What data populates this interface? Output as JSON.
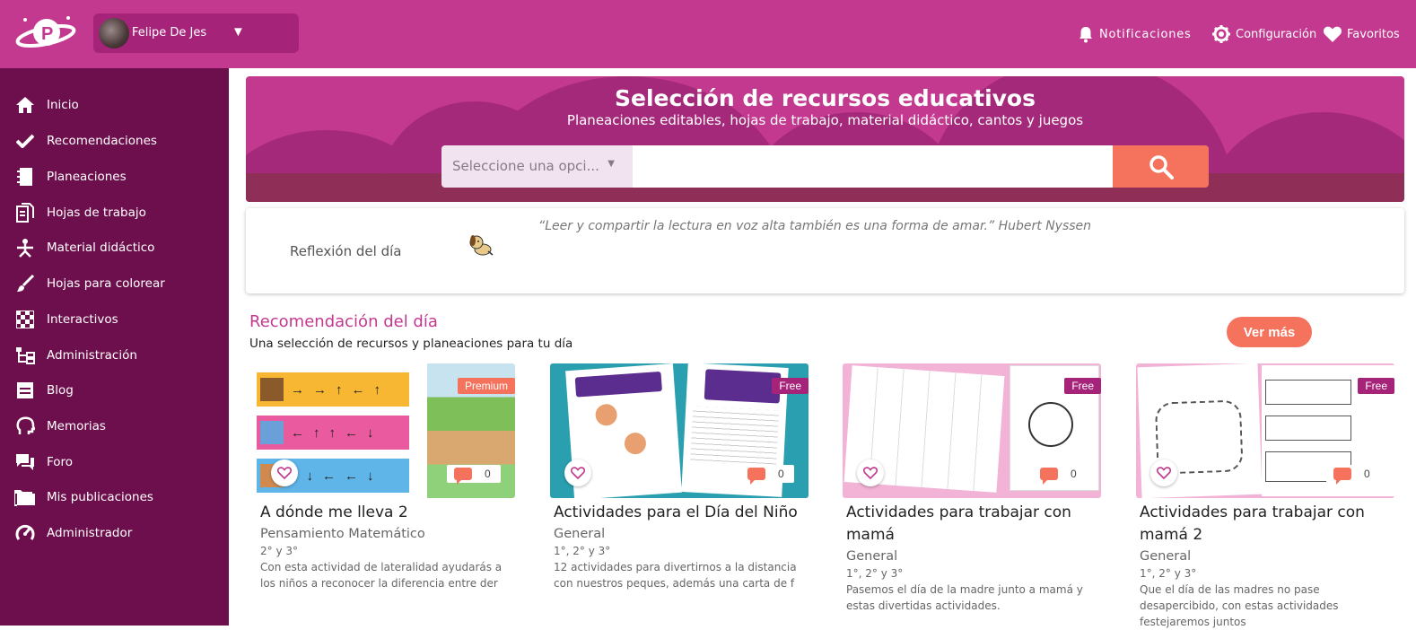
{
  "topbar": {
    "user_name": "Felipe De Jes",
    "actions": {
      "notifications": "Notificaciones",
      "settings": "Configuración",
      "favorites": "Favoritos"
    }
  },
  "sidebar": {
    "items": [
      {
        "label": "Inicio",
        "icon": "home-icon"
      },
      {
        "label": "Recomendaciones",
        "icon": "check-icon"
      },
      {
        "label": "Planeaciones",
        "icon": "notebook-icon"
      },
      {
        "label": "Hojas de trabajo",
        "icon": "document-icon"
      },
      {
        "label": "Material didáctico",
        "icon": "playground-icon"
      },
      {
        "label": "Hojas para colorear",
        "icon": "brush-icon"
      },
      {
        "label": "Interactivos",
        "icon": "checkerboard-icon"
      },
      {
        "label": "Administración",
        "icon": "hierarchy-icon"
      },
      {
        "label": "Blog",
        "icon": "blog-icon"
      },
      {
        "label": "Memorias",
        "icon": "head-icon"
      },
      {
        "label": "Foro",
        "icon": "chat-icon"
      },
      {
        "label": "Mis publicaciones",
        "icon": "folder-icon"
      },
      {
        "label": "Administrador",
        "icon": "gauge-icon"
      }
    ]
  },
  "hero": {
    "title": "Selección de recursos educativos",
    "subtitle": "Planeaciones editables, hojas de trabajo, material didáctico, cantos y juegos",
    "select_placeholder": "Seleccione una opci...",
    "search_value": ""
  },
  "reflection": {
    "label": "Reflexión del día",
    "quote": "“Leer y compartir la lectura en voz alta también es una forma de amar.” Hubert Nyssen"
  },
  "recommendations": {
    "title": "Recomendación del día",
    "subtitle": "Una selección de recursos y planeaciones para tu día",
    "more_button": "Ver más",
    "cards": [
      {
        "badge": "Premium",
        "badge_color": "#f5725d",
        "comments": "0",
        "title": "A dónde me lleva 2",
        "category": "Pensamiento Matemático",
        "grade": "2° y 3°",
        "description": "Con esta actividad de lateralidad ayudarás a los niños a reconocer la diferencia entre der"
      },
      {
        "badge": "Free",
        "badge_color": "#a6237a",
        "comments": "0",
        "title": "Actividades para el Día del Niño",
        "category": "General",
        "grade": "1°, 2° y 3°",
        "description": "12 actividades para divertirnos a la distancia con nuestros peques, además una carta de f"
      },
      {
        "badge": "Free",
        "badge_color": "#a6237a",
        "comments": "0",
        "title": "Actividades para trabajar con mamá",
        "category": "General",
        "grade": "1°, 2° y 3°",
        "description": "Pasemos el día de la madre junto a mamá y estas divertidas actividades."
      },
      {
        "badge": "Free",
        "badge_color": "#a6237a",
        "comments": "0",
        "title": "Actividades para trabajar con mamá 2",
        "category": "General",
        "grade": "1°, 2° y 3°",
        "description": "Que el día de las madres no pase desapercibido, con estas actividades festejaremos juntos"
      }
    ]
  },
  "colors": {
    "brand": "#c2398f",
    "sidebar": "#6e0f4d",
    "accent": "#f5725d"
  }
}
